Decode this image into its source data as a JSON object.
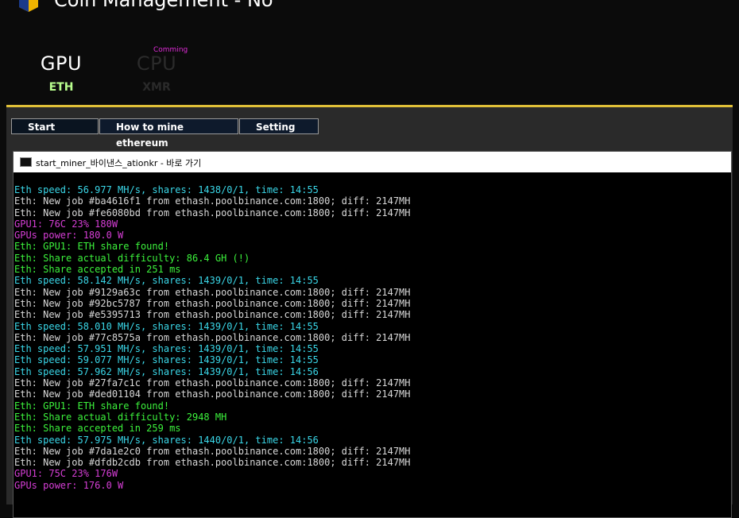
{
  "window": {
    "title": "Coin Management - No",
    "close_icon": "close-icon"
  },
  "modes": {
    "gpu": {
      "label": "GPU",
      "coin": "ETH"
    },
    "cpu": {
      "label": "CPU",
      "coin": "XMR",
      "badge": "Comming"
    }
  },
  "toolbar": {
    "start_label": "Start",
    "howto_label": "How to mine ethereum",
    "setting_label": "Setting"
  },
  "console": {
    "title": "start_miner_바이낸스_ationkr - 바로 가기",
    "lines": [
      {
        "text": "Eth speed: 56.977 MH/s, shares: 1438/0/1, time: 14:55",
        "color": "cyan"
      },
      {
        "text": "Eth: New job #ba4616f1 from ethash.poolbinance.com:1800; diff: 2147MH",
        "color": "white"
      },
      {
        "text": "Eth: New job #fe6080bd from ethash.poolbinance.com:1800; diff: 2147MH",
        "color": "white"
      },
      {
        "text": "GPU1: 76C 23% 180W",
        "color": "mag"
      },
      {
        "text": "GPUs power: 180.0 W",
        "color": "mag"
      },
      {
        "text": "Eth: GPU1: ETH share found!",
        "color": "green"
      },
      {
        "text": "Eth: Share actual difficulty: 86.4 GH (!)",
        "color": "green"
      },
      {
        "text": "Eth: Share accepted in 251 ms",
        "color": "green"
      },
      {
        "text": "Eth speed: 58.142 MH/s, shares: 1439/0/1, time: 14:55",
        "color": "cyan"
      },
      {
        "text": "Eth: New job #9129a63c from ethash.poolbinance.com:1800; diff: 2147MH",
        "color": "white"
      },
      {
        "text": "Eth: New job #92bc5787 from ethash.poolbinance.com:1800; diff: 2147MH",
        "color": "white"
      },
      {
        "text": "Eth: New job #e5395713 from ethash.poolbinance.com:1800; diff: 2147MH",
        "color": "white"
      },
      {
        "text": "Eth speed: 58.010 MH/s, shares: 1439/0/1, time: 14:55",
        "color": "cyan"
      },
      {
        "text": "Eth: New job #77c8575a from ethash.poolbinance.com:1800; diff: 2147MH",
        "color": "white"
      },
      {
        "text": "Eth speed: 57.951 MH/s, shares: 1439/0/1, time: 14:55",
        "color": "cyan"
      },
      {
        "text": "Eth speed: 59.077 MH/s, shares: 1439/0/1, time: 14:55",
        "color": "cyan"
      },
      {
        "text": "Eth speed: 57.962 MH/s, shares: 1439/0/1, time: 14:56",
        "color": "cyan"
      },
      {
        "text": "Eth: New job #27fa7c1c from ethash.poolbinance.com:1800; diff: 2147MH",
        "color": "white"
      },
      {
        "text": "Eth: New job #ded01104 from ethash.poolbinance.com:1800; diff: 2147MH",
        "color": "white"
      },
      {
        "text": "Eth: GPU1: ETH share found!",
        "color": "green"
      },
      {
        "text": "Eth: Share actual difficulty: 2948 MH",
        "color": "green"
      },
      {
        "text": "Eth: Share accepted in 259 ms",
        "color": "green"
      },
      {
        "text": "Eth speed: 57.975 MH/s, shares: 1440/0/1, time: 14:56",
        "color": "cyan"
      },
      {
        "text": "Eth: New job #7da1e2c0 from ethash.poolbinance.com:1800; diff: 2147MH",
        "color": "white"
      },
      {
        "text": "Eth: New job #dfdb2cdb from ethash.poolbinance.com:1800; diff: 2147MH",
        "color": "white"
      },
      {
        "text": "GPU1: 75C 23% 176W",
        "color": "mag"
      },
      {
        "text": "GPUs power: 176.0 W",
        "color": "mag"
      }
    ]
  },
  "colors": {
    "accent_gold": "#e0c038",
    "gpu_coin_green": "#b8ff8e",
    "badge_magenta": "#e02bd8",
    "log_cyan": "#3ad7e8",
    "log_white": "#d8d8d8",
    "log_magenta": "#d63ed6",
    "log_green": "#3cf23c"
  }
}
